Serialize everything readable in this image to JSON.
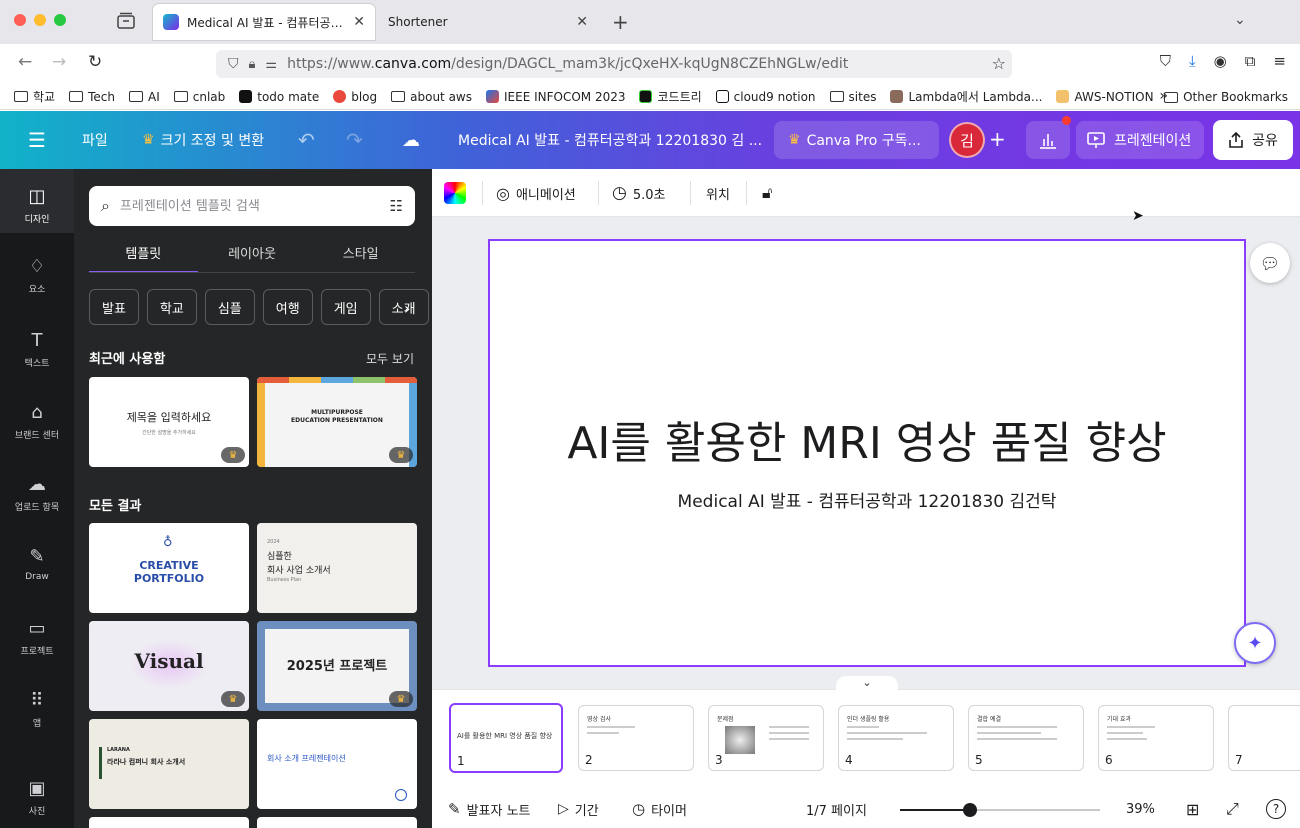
{
  "browser": {
    "tabs": [
      {
        "title": "Medical AI 발표 - 컴퓨터공학과 12201830 김",
        "active": true
      },
      {
        "title": "Shortener",
        "active": false
      }
    ],
    "url_prefix": "https://www.",
    "url_domain": "canva.com",
    "url_path": "/design/DAGCL_mam3k/jcQxeHX-kqUgN8CZEhNGLw/edit",
    "bookmarks": [
      "학교",
      "Tech",
      "AI",
      "cnlab",
      "todo mate",
      "blog",
      "about aws",
      "IEEE INFOCOM 2023",
      "코드트리",
      "cloud9 notion",
      "sites",
      "Lambda에서 Lambda...",
      "AWS-NOTION"
    ],
    "other_bookmarks": "Other Bookmarks"
  },
  "header": {
    "file": "파일",
    "resize": "크기 조정 및 변환",
    "title": "Medical AI 발표 - 컴퓨터공학과 12201830 김   ...",
    "pro": "Canva Pro 구독...",
    "avatar": "김",
    "present": "프레젠테이션",
    "share": "공유"
  },
  "rail": [
    {
      "label": "디자인",
      "icon": "design-icon",
      "glyph": "◫"
    },
    {
      "label": "요소",
      "icon": "elements-icon",
      "glyph": "♢"
    },
    {
      "label": "텍스트",
      "icon": "text-icon",
      "glyph": "T"
    },
    {
      "label": "브랜드 센터",
      "icon": "brand-icon",
      "glyph": "⌂"
    },
    {
      "label": "업로드 항목",
      "icon": "upload-icon",
      "glyph": "☁"
    },
    {
      "label": "Draw",
      "icon": "draw-icon",
      "glyph": "✎"
    },
    {
      "label": "프로젝트",
      "icon": "folder-icon",
      "glyph": "▭"
    },
    {
      "label": "앱",
      "icon": "apps-icon",
      "glyph": "⠿"
    },
    {
      "label": "사진",
      "icon": "photo-icon",
      "glyph": "▣"
    }
  ],
  "panel": {
    "search_placeholder": "프레젠테이션 템플릿 검색",
    "tabs": [
      "템플릿",
      "레이아웃",
      "스타일"
    ],
    "chips": [
      "발표",
      "학교",
      "심플",
      "여행",
      "게임",
      "소개"
    ],
    "recent_heading": "최근에 사용함",
    "see_all": "모두 보기",
    "all_results": "모든 결과",
    "recent": [
      {
        "line1": "제목을 입력하세요",
        "line2": "간단한 설명을 추가하세요"
      },
      {
        "line1": "MULTIPURPOSE",
        "line2": "EDUCATION PRESENTATION"
      }
    ],
    "results": [
      {
        "line1": "CREATIVE",
        "line2": "PORTFOLIO"
      },
      {
        "line1": "2024",
        "line2": "심플한",
        "line3": "회사 사업 소개서",
        "line4": "Business Plan"
      },
      {
        "line1": "Visual"
      },
      {
        "line1": "2025년 프로젝트"
      },
      {
        "line1": "LARANA",
        "line2": "라라나 컴퍼니 회사 소개서"
      },
      {
        "line1": "회사 소개 프레젠테이션"
      }
    ]
  },
  "toolbar": {
    "animation": "애니메이션",
    "duration": "5.0초",
    "position": "위치"
  },
  "slide": {
    "title": "AI를 활용한 MRI 영상 품질 향상",
    "subtitle": "Medical AI 발표 - 컴퓨터공학과 12201830 김건탁"
  },
  "pages": [
    {
      "num": "1",
      "title": "AI를 활용한 MRI 영상 품질 향상"
    },
    {
      "num": "2",
      "title": "영상 검사"
    },
    {
      "num": "3",
      "title": "문제점"
    },
    {
      "num": "4",
      "title": "인더 생플링 활용"
    },
    {
      "num": "5",
      "title": "결합 예결"
    },
    {
      "num": "6",
      "title": "기대 효과"
    },
    {
      "num": "7",
      "title": ""
    }
  ],
  "footer": {
    "notes": "발표자 노트",
    "duration": "기간",
    "timer": "타이머",
    "page": "1/7 페이지",
    "zoom": "39%",
    "zoom_fraction": 0.35
  },
  "colors": {
    "accent": "#8b3dff",
    "avatar": "#d8283a",
    "rail_bg": "#18191b",
    "panel_bg": "#252627"
  }
}
